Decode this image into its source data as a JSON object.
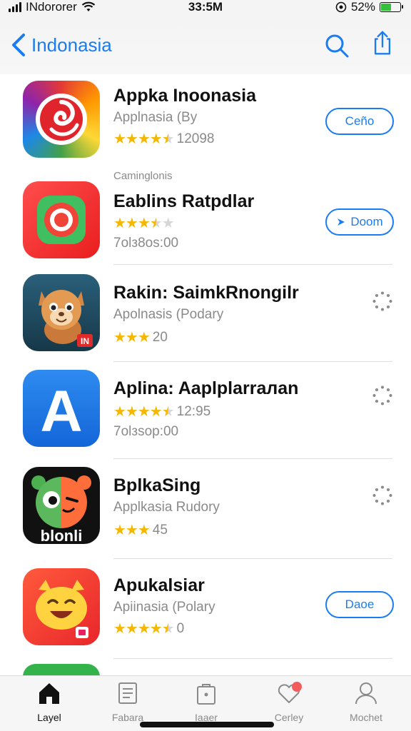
{
  "status": {
    "carrier": "INdororer",
    "time": "33:5M",
    "battery": "52%",
    "battery_level": 0.52
  },
  "nav": {
    "title": "Indonasia",
    "back_icon": "chevron-left-icon",
    "search_icon": "search-icon",
    "share_icon": "share-icon"
  },
  "apps": [
    {
      "name": "Appka Inoonasia",
      "subtitle": "Applnasia (By",
      "stars": 4.5,
      "rating_text": "12098",
      "button": "Ceño",
      "icon": "swirl-app-icon"
    },
    {
      "section": "Caminglonis",
      "name": "Eablins Ratpdlar",
      "stars": 3.5,
      "rating_text": "",
      "subtitle": "7olз8os:00",
      "button": "Doom",
      "icon": "camera-app-icon"
    },
    {
      "name": "Rakin: SaimkRnongilr",
      "subtitle": "Apolnasis (Podary",
      "stars": 3,
      "rating_text": "20",
      "icon": "squirrel-app-icon",
      "badge": "IN"
    },
    {
      "name": "Aplina: Aaplplarraлan",
      "stars": 4.5,
      "rating_text": "12:95",
      "subtitle": "7olзsop:00",
      "icon": "letter-a-app-icon",
      "letter": "A"
    },
    {
      "name": "BplkaSing",
      "subtitle": "Applkasia Rudory",
      "stars": 3,
      "rating_text": "45",
      "icon": "monster-app-icon",
      "label": "blonli"
    },
    {
      "name": "Apukalsiar",
      "subtitle": "Apiinasia (Polary",
      "stars": 4.5,
      "rating_text": "0",
      "button": "Daoe",
      "icon": "cat-app-icon"
    }
  ],
  "tabs": [
    {
      "label": "Layel",
      "icon": "home-icon",
      "active": true
    },
    {
      "label": "Fabara",
      "icon": "document-icon",
      "active": false
    },
    {
      "label": "Iaaer",
      "icon": "bag-icon",
      "active": false
    },
    {
      "label": "Cerley",
      "icon": "heart-icon",
      "active": false
    },
    {
      "label": "Mochet",
      "icon": "person-icon",
      "active": false
    }
  ],
  "colors": {
    "accent": "#1a7cf2",
    "star": "#f5b800",
    "badge": "#f25c5c"
  }
}
